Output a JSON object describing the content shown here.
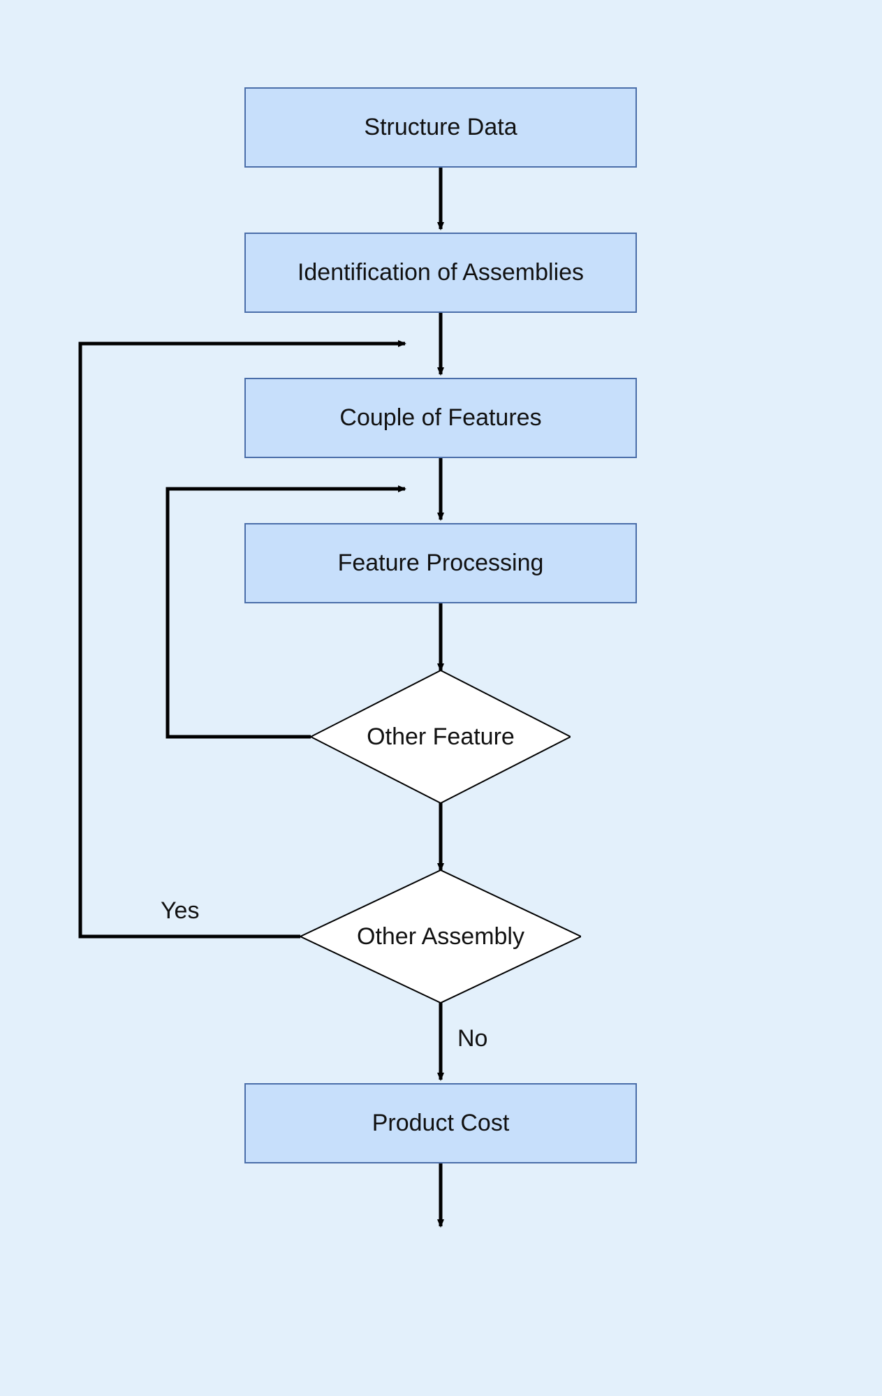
{
  "nodes": {
    "structure_data": "Structure Data",
    "identification": "Identification of Assemblies",
    "couple_features": "Couple of Features",
    "feature_processing": "Feature Processing",
    "other_feature": "Other Feature",
    "other_assembly": "Other Assembly",
    "product_cost": "Product Cost"
  },
  "labels": {
    "yes": "Yes",
    "no": "No"
  },
  "flow": {
    "description": "Flowchart: Structure Data → Identification of Assemblies → Couple of Features → Feature Processing → decision Other Feature (loops back to Feature Processing) → decision Other Assembly (Yes loops back to Couple of Features, No → Product Cost → end).",
    "edges": [
      [
        "structure_data",
        "identification",
        ""
      ],
      [
        "identification",
        "couple_features",
        ""
      ],
      [
        "couple_features",
        "feature_processing",
        ""
      ],
      [
        "feature_processing",
        "other_feature",
        ""
      ],
      [
        "other_feature",
        "other_assembly",
        ""
      ],
      [
        "other_feature",
        "feature_processing",
        "loop-back"
      ],
      [
        "other_assembly",
        "couple_features",
        "Yes"
      ],
      [
        "other_assembly",
        "product_cost",
        "No"
      ],
      [
        "product_cost",
        "end",
        ""
      ]
    ]
  },
  "colors": {
    "background": "#e3f0fb",
    "box_fill": "#c7dffb",
    "box_border": "#4a6ea9",
    "decision_fill": "#ffffff",
    "arrow": "#000000"
  }
}
